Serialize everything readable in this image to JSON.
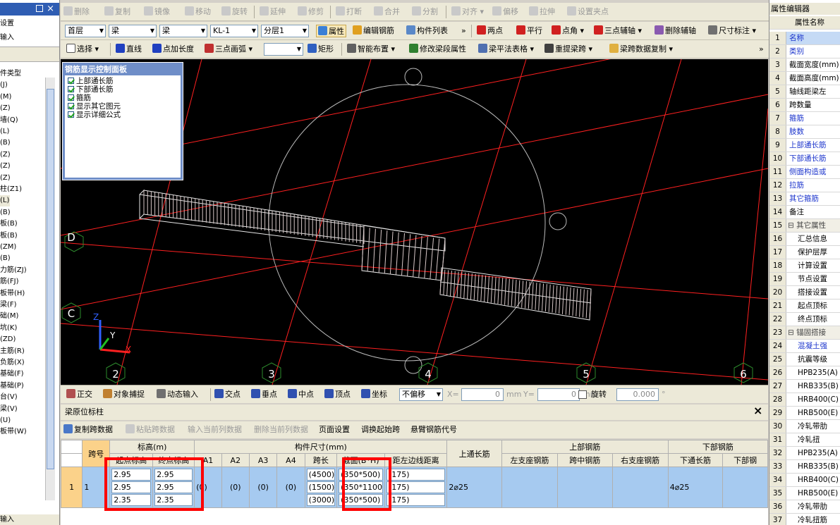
{
  "left_panel": {
    "title": "设置",
    "input_label": "输入",
    "pin": "",
    "close": "×",
    "tree": [
      "件类型",
      "(J)",
      "(M)",
      "(Z)",
      "墙(Q)",
      "(L)",
      "(B)",
      "(Z)",
      "(Z)",
      "(Z)",
      "柱(Z1)",
      "(L)",
      "(B)",
      "板(B)",
      "板(B)",
      "(ZM)",
      "(B)",
      "力筋(ZJ)",
      "筋(FJ)",
      "板带(H)",
      "梁(F)",
      "础(M)",
      "坑(K)",
      "(ZD)",
      "主筋(R)",
      "负筋(X)",
      "基础(F)",
      "基础(P)",
      "台(V)",
      "梁(V)",
      "(U)",
      "板带(W)"
    ],
    "bottom_input": "输入"
  },
  "toolbar1": {
    "items": [
      "删除",
      "复制",
      "镜像",
      "移动",
      "旋转",
      "延伸",
      "修剪",
      "打断",
      "合并",
      "分割",
      "对齐",
      "偏移",
      "拉伸",
      "设置夹点"
    ]
  },
  "toolbar2": {
    "floor": "首层",
    "category": "梁",
    "type": "梁",
    "element": "KL-1",
    "layer": "分层1",
    "items": [
      "属性",
      "编辑钢筋",
      "构件列表",
      "两点",
      "平行",
      "点角",
      "三点辅轴",
      "删除辅轴",
      "尺寸标注"
    ],
    "more": "»"
  },
  "toolbar3": {
    "items": [
      "选择",
      "直线",
      "点加长度",
      "三点画弧",
      "矩形",
      "智能布置",
      "修改梁段属性",
      "梁平法表格",
      "重提梁跨",
      "梁跨数据复制"
    ],
    "more": "»"
  },
  "control_panel": {
    "title": "钢筋显示控制面板",
    "options": [
      "上部通长筋",
      "下部通长筋",
      "箍筋",
      "显示其它图元",
      "显示详细公式"
    ]
  },
  "axes": {
    "rows": [
      "D",
      "C"
    ],
    "cols": [
      "2",
      "3",
      "4",
      "5",
      "6"
    ],
    "z": "Z",
    "y": "Y",
    "x": "X"
  },
  "snapbar": {
    "items": [
      "正交",
      "对象捕捉",
      "动态输入",
      "交点",
      "垂点",
      "中点",
      "顶点",
      "坐标"
    ],
    "offset_mode": "不偏移",
    "x_label": "X=",
    "x_value": "0",
    "y_label": "Y=",
    "y_value": "0",
    "unit": "mm",
    "rotate_label": "旋转",
    "rotate_value": "0.000",
    "deg": "°"
  },
  "bottom_panel": {
    "title": "梁原位标柱",
    "close": "×",
    "tools": [
      "复制跨数据",
      "粘贴跨数据",
      "输入当前列数据",
      "删除当前列数据",
      "页面设置",
      "调换起始跨",
      "悬臂钢筋代号"
    ],
    "header1": [
      "跨号",
      "标高(m)",
      "构件尺寸(mm)",
      "上通长筋",
      "上部钢筋",
      "下部钢筋"
    ],
    "header2": [
      "起点标高",
      "终点标高",
      "A1",
      "A2",
      "A3",
      "A4",
      "跨长",
      "截面(B*H)",
      "距左边线距离",
      "左支座钢筋",
      "跨中钢筋",
      "右支座钢筋",
      "下通长筋",
      "下部钢"
    ],
    "row_index": "1",
    "span_no": "1",
    "start_elev": [
      "2.95",
      "2.95",
      "2.35"
    ],
    "end_elev": [
      "2.95",
      "2.95",
      "2.35"
    ],
    "a_vals": [
      "(0)",
      "(0)",
      "(0)",
      "(0)"
    ],
    "span_len": [
      "(4500)",
      "(1500)",
      "(3000)"
    ],
    "section": [
      "(350*500)",
      "(350*1100",
      "(350*500)"
    ],
    "left_dist": [
      "(175)",
      "(175)",
      "(175)"
    ],
    "top_through": "2⌀25",
    "bottom_through": "4⌀25"
  },
  "right_panel": {
    "title": "属性编辑器",
    "header": "属性名称",
    "rows": [
      {
        "n": "1",
        "t": "名称",
        "c": "blue"
      },
      {
        "n": "2",
        "t": "类别",
        "c": "blue"
      },
      {
        "n": "3",
        "t": "截面宽度(mm)",
        "c": ""
      },
      {
        "n": "4",
        "t": "截面高度(mm)",
        "c": ""
      },
      {
        "n": "5",
        "t": "轴线距梁左",
        "c": ""
      },
      {
        "n": "6",
        "t": "跨数量",
        "c": ""
      },
      {
        "n": "7",
        "t": "箍筋",
        "c": "blue"
      },
      {
        "n": "8",
        "t": "肢数",
        "c": "blue"
      },
      {
        "n": "9",
        "t": "上部通长筋",
        "c": "blue"
      },
      {
        "n": "10",
        "t": "下部通长筋",
        "c": "blue"
      },
      {
        "n": "11",
        "t": "侧面构造或",
        "c": "blue"
      },
      {
        "n": "12",
        "t": "拉筋",
        "c": "blue"
      },
      {
        "n": "13",
        "t": "其它箍筋",
        "c": "blue"
      },
      {
        "n": "14",
        "t": "备注",
        "c": ""
      },
      {
        "n": "15",
        "t": "⊟ 其它属性",
        "c": "gray"
      },
      {
        "n": "16",
        "t": "汇总信息",
        "c": ""
      },
      {
        "n": "17",
        "t": "保护层厚",
        "c": ""
      },
      {
        "n": "18",
        "t": "计算设置",
        "c": ""
      },
      {
        "n": "19",
        "t": "节点设置",
        "c": ""
      },
      {
        "n": "20",
        "t": "搭接设置",
        "c": ""
      },
      {
        "n": "21",
        "t": "起点顶标",
        "c": ""
      },
      {
        "n": "22",
        "t": "终点顶标",
        "c": ""
      },
      {
        "n": "23",
        "t": "⊟ 锚固搭接",
        "c": "gray"
      },
      {
        "n": "24",
        "t": "混凝土强",
        "c": "blue"
      },
      {
        "n": "25",
        "t": "抗震等级",
        "c": ""
      },
      {
        "n": "26",
        "t": "HPB235(A)",
        "c": ""
      },
      {
        "n": "27",
        "t": "HRB335(B)",
        "c": ""
      },
      {
        "n": "28",
        "t": "HRB400(C)",
        "c": ""
      },
      {
        "n": "29",
        "t": "HRB500(E)",
        "c": ""
      },
      {
        "n": "30",
        "t": "冷轧带肋",
        "c": ""
      },
      {
        "n": "31",
        "t": "冷轧扭",
        "c": ""
      },
      {
        "n": "32",
        "t": "HPB235(A)",
        "c": ""
      },
      {
        "n": "33",
        "t": "HRB335(B)",
        "c": ""
      },
      {
        "n": "34",
        "t": "HRB400(C)",
        "c": ""
      },
      {
        "n": "35",
        "t": "HRB500(E)",
        "c": ""
      },
      {
        "n": "36",
        "t": "冷轧带肋",
        "c": ""
      },
      {
        "n": "37",
        "t": "冷轧扭筋",
        "c": ""
      }
    ]
  }
}
